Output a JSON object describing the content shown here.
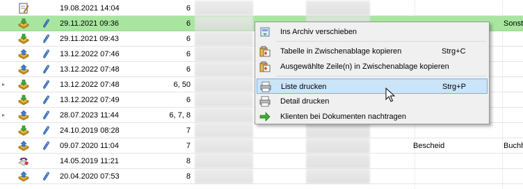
{
  "rows": [
    {
      "expander": "",
      "doc_icon": "edit-doc-icon",
      "attachment": false,
      "date": "19.08.2021 14:04",
      "num": "6",
      "col_e": "",
      "col_f": "",
      "selected": false
    },
    {
      "expander": "",
      "doc_icon": "download-doc-icon",
      "attachment": true,
      "date": "29.11.2021 09:36",
      "num": "6",
      "col_e": "",
      "col_f": "Sonst",
      "selected": true
    },
    {
      "expander": "",
      "doc_icon": "download-doc-icon",
      "attachment": true,
      "date": "29.11.2021 09:43",
      "num": "6",
      "col_e": "",
      "col_f": "",
      "selected": false
    },
    {
      "expander": "",
      "doc_icon": "upload-doc-icon",
      "attachment": true,
      "date": "13.12.2022 07:46",
      "num": "6",
      "col_e": "",
      "col_f": "",
      "selected": false
    },
    {
      "expander": "",
      "doc_icon": "upload-doc-icon",
      "attachment": true,
      "date": "13.12.2022 07:48",
      "num": "6",
      "col_e": "",
      "col_f": "",
      "selected": false
    },
    {
      "expander": "▸",
      "doc_icon": "download-doc-icon",
      "attachment": true,
      "date": "13.12.2022 07:48",
      "num": "6, 50",
      "col_e": "",
      "col_f": "",
      "selected": false
    },
    {
      "expander": "",
      "doc_icon": "download-doc-icon",
      "attachment": true,
      "date": "13.12.2022 07:49",
      "num": "6",
      "col_e": "",
      "col_f": "",
      "selected": false
    },
    {
      "expander": "▸",
      "doc_icon": "upload-doc-icon",
      "attachment": true,
      "date": "28.07.2023 11:44",
      "num": "6, 7, 8",
      "col_e": "",
      "col_f": "",
      "selected": false
    },
    {
      "expander": "",
      "doc_icon": "download-doc-icon",
      "attachment": true,
      "date": "24.10.2019 08:28",
      "num": "7",
      "col_e": "",
      "col_f": "",
      "selected": false
    },
    {
      "expander": "",
      "doc_icon": "upload-doc-icon",
      "attachment": true,
      "date": "09.07.2020 11:04",
      "num": "7",
      "col_e": "Bescheid",
      "col_f": "Buchh",
      "selected": false
    },
    {
      "expander": "",
      "doc_icon": "phone-doc-icon",
      "attachment": false,
      "date": "14.05.2019 11:21",
      "num": "8",
      "col_e": "",
      "col_f": "",
      "selected": false
    },
    {
      "expander": "",
      "doc_icon": "upload-doc-icon",
      "attachment": true,
      "date": "20.04.2020 07:53",
      "num": "8",
      "col_e": "",
      "col_f": "",
      "selected": false
    }
  ],
  "context_menu": {
    "items": [
      {
        "icon": "archive-icon",
        "label": "Ins Archiv verschieben",
        "shortcut": "",
        "highlighted": false
      },
      {
        "icon": "copy-table-icon",
        "label": "Tabelle in Zwischenablage kopieren",
        "shortcut": "Strg+C",
        "highlighted": false
      },
      {
        "icon": "copy-rows-icon",
        "label": "Ausgewählte Zeile(n) in Zwischenablage kopieren",
        "shortcut": "",
        "highlighted": false
      },
      {
        "icon": "print-list-icon",
        "label": "Liste drucken",
        "shortcut": "Strg+P",
        "highlighted": true
      },
      {
        "icon": "print-detail-icon",
        "label": "Detail drucken",
        "shortcut": "",
        "highlighted": false
      },
      {
        "icon": "arrow-right-icon",
        "label": "Klienten bei Dokumenten nachtragen",
        "shortcut": "",
        "highlighted": false
      }
    ]
  },
  "colors": {
    "selected_row": "#a8e6a0",
    "menu_highlight": "#cce4f7",
    "menu_bg": "#f0f0f0"
  }
}
